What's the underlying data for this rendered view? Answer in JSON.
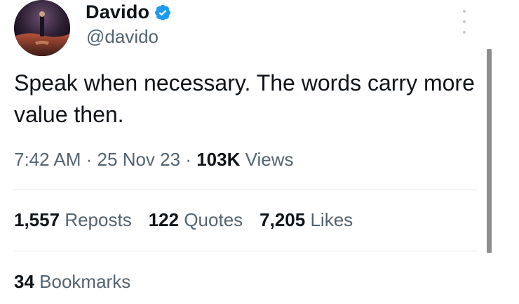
{
  "author": {
    "display_name": "Davido",
    "handle": "@davido",
    "verified": true
  },
  "tweet": {
    "text": "Speak when necessary. The words carry more value then.",
    "time": "7:42 AM",
    "date": "25 Nov 23",
    "views_count": "103K",
    "views_label": "Views",
    "separator": "·"
  },
  "stats": {
    "reposts_count": "1,557",
    "reposts_label": "Reposts",
    "quotes_count": "122",
    "quotes_label": "Quotes",
    "likes_count": "7,205",
    "likes_label": "Likes",
    "bookmarks_count": "34",
    "bookmarks_label": "Bookmarks"
  },
  "colors": {
    "text_primary": "#0f1419",
    "text_secondary": "#536471",
    "verified_badge": "#1d9bf0",
    "divider": "#e4e7ea"
  },
  "icons": {
    "verified": "verified-badge-icon",
    "more": "more-vertical-icon"
  }
}
